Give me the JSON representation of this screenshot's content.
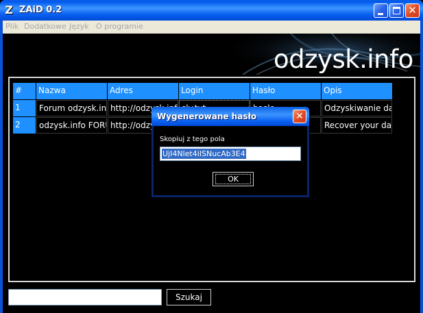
{
  "window": {
    "title": "ZAiD 0.2",
    "app_icon_glyph": "Z"
  },
  "menu": [
    {
      "label": "Plik"
    },
    {
      "label": "Dodatkowe"
    },
    {
      "label": "Język"
    },
    {
      "label": "O programie"
    }
  ],
  "logo": {
    "text": "odzysk.info"
  },
  "table": {
    "headers": [
      "#",
      "Nazwa",
      "Adres",
      "Login",
      "Hasło",
      "Opis"
    ],
    "rows": [
      [
        "1",
        "Forum odzysk.info",
        "http://odzysk.info",
        "sly.txt",
        "haslo",
        "Odzyskiwanie danych"
      ],
      [
        "2",
        "odzysk.info FORUM",
        "http://odzysk.info",
        "",
        "",
        "Recover your data"
      ]
    ]
  },
  "search": {
    "value": "",
    "button_label": "Szukaj"
  },
  "dialog": {
    "title": "Wygenerowane hasło",
    "label": "Skopiuj z tego pola",
    "value": "UjI4Nlet4iISNucAb3E4",
    "ok_label": "OK"
  },
  "colors": {
    "accent": "#1e90ff",
    "selection": "#316ac5",
    "titlebar": "#0a61f0"
  }
}
